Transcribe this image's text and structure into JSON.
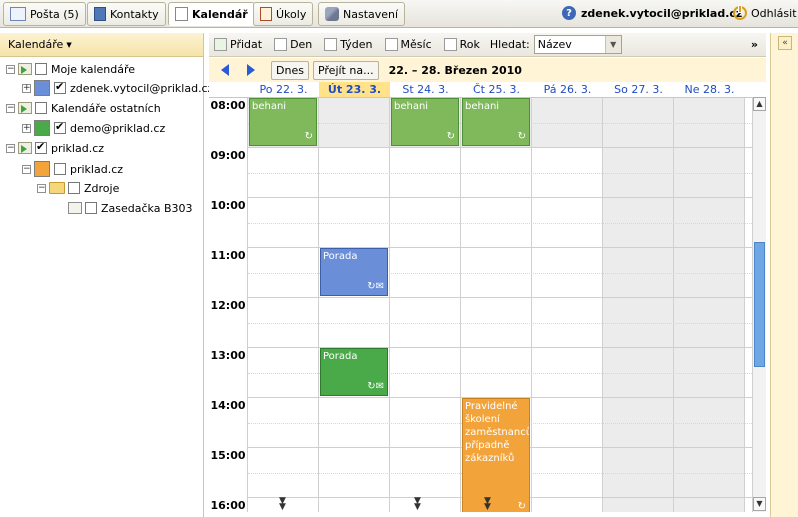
{
  "tabs": [
    {
      "label": "Pošta (5)",
      "icon": "envelope-icon"
    },
    {
      "label": "Kontakty",
      "icon": "addressbook-icon"
    },
    {
      "label": "Kalendář",
      "icon": "calendar-icon",
      "active": true
    },
    {
      "label": "Úkoly",
      "icon": "tasks-icon"
    },
    {
      "label": "Nastavení",
      "icon": "wrench-icon"
    }
  ],
  "user": {
    "email": "zdenek.vytocil@priklad.cz",
    "logout": "Odhlásit"
  },
  "sidebar": {
    "header": "Kalendáře",
    "tree": {
      "my_calendars": "Moje kalendáře",
      "my_calendar": "zdenek.vytocil@priklad.cz",
      "others": "Kalendáře ostatních",
      "demo": "demo@priklad.cz",
      "domain": "priklad.cz",
      "domain_cal": "priklad.cz",
      "resources": "Zdroje",
      "room": "Zasedačka B303"
    },
    "colors": {
      "my": "#6a8fd8",
      "demo": "#4aaa4a",
      "domain": "#f2a33a"
    }
  },
  "toolbar": {
    "add": "Přidat",
    "day": "Den",
    "week": "Týden",
    "month": "Měsíc",
    "year": "Rok",
    "search_label": "Hledat:",
    "search_value": "Název",
    "more": "»"
  },
  "nav": {
    "today": "Dnes",
    "goto": "Přejít na...",
    "range": "22. – 28. Březen 2010"
  },
  "days": [
    "Po 22. 3.",
    "Út 23. 3.",
    "St 24. 3.",
    "Čt 25. 3.",
    "Pá 26. 3.",
    "So 27. 3.",
    "Ne 28. 3."
  ],
  "hours": [
    "08:00",
    "09:00",
    "10:00",
    "11:00",
    "12:00",
    "13:00",
    "14:00",
    "15:00",
    "16:00"
  ],
  "events": {
    "e1": "behani",
    "e2": "behani",
    "e3": "behani",
    "e4": "Porada",
    "e5": "Porada",
    "e6": "Pravidelné školení zaměstnanců, případně zákazníků"
  }
}
